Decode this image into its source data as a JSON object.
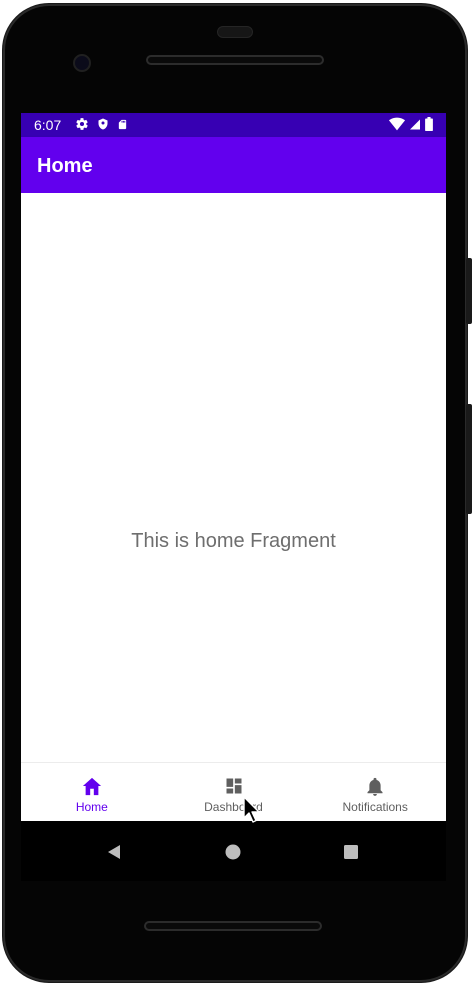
{
  "status_bar": {
    "time": "6:07",
    "left_icons": [
      "gear-icon",
      "shield-icon",
      "sd-card-icon"
    ],
    "right_icons": [
      "wifi-icon",
      "cell-signal-icon",
      "battery-icon"
    ],
    "background": "#3700b3"
  },
  "app_bar": {
    "title": "Home",
    "background": "#6200ee"
  },
  "content": {
    "text": "This is home Fragment"
  },
  "bottom_nav": {
    "items": [
      {
        "label": "Home",
        "icon": "home-icon",
        "active": true
      },
      {
        "label": "Dashboard",
        "icon": "dashboard-icon",
        "active": false
      },
      {
        "label": "Notifications",
        "icon": "bell-icon",
        "active": false
      }
    ],
    "active_color": "#6200ee",
    "inactive_color": "#5f5f5f"
  },
  "system_nav": {
    "buttons": [
      "back-icon",
      "home-circle-icon",
      "recents-icon"
    ]
  }
}
